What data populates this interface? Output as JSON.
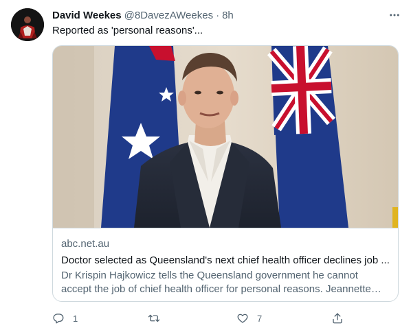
{
  "tweet": {
    "author": {
      "display_name": "David Weekes",
      "handle": "@8DavezAWeekes",
      "separator": "·",
      "time": "8h"
    },
    "text": "Reported as 'personal reasons'...",
    "card": {
      "domain": "abc.net.au",
      "title": "Doctor selected as Queensland's next chief health officer declines job ...",
      "description": "Dr Krispin Hajkowicz tells the Queensland government he cannot accept the job of chief health officer for personal reasons. Jeannette Young is ..."
    },
    "actions": {
      "reply_count": "1",
      "retweet_count": "",
      "like_count": "7"
    }
  },
  "icons": {
    "more": "more-horizontal-icon",
    "reply": "reply-icon",
    "retweet": "retweet-icon",
    "like": "heart-icon",
    "share": "share-icon"
  },
  "colors": {
    "text_primary": "#0f1419",
    "text_secondary": "#536471",
    "border": "#cfd9de"
  }
}
